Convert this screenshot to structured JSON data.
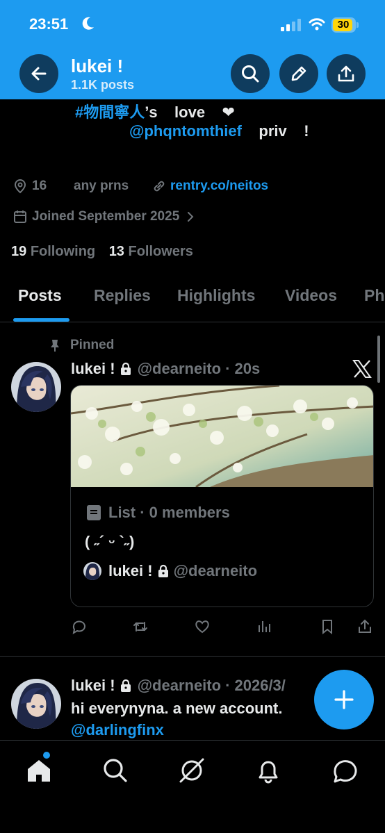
{
  "status_bar": {
    "time": "23:51",
    "battery": "30",
    "battery_color": "#ffd60a"
  },
  "header": {
    "name": "lukei !",
    "post_count": "1.1K posts",
    "background": "#1d9bf0",
    "buttons": [
      "back-icon",
      "search-icon",
      "edit-icon",
      "share-icon"
    ]
  },
  "bio": {
    "hashtag": "#物間寧人",
    "line1_rest": "’s    love    ❤",
    "mention": "@phqntomthief",
    "line2_rest": "    priv    !"
  },
  "meta": {
    "location": "16",
    "pronouns": "any prns",
    "link": "rentry.co/neitos",
    "joined": "Joined September 2025"
  },
  "stats": {
    "following_count": "19",
    "following_label": "Following",
    "followers_count": "13",
    "followers_label": "Followers"
  },
  "tabs": [
    {
      "label": "Posts",
      "active": true
    },
    {
      "label": "Replies",
      "active": false
    },
    {
      "label": "Highlights",
      "active": false
    },
    {
      "label": "Videos",
      "active": false
    },
    {
      "label": "Ph",
      "active": false
    }
  ],
  "posts": [
    {
      "pinned_label": "Pinned",
      "name": "lukei !",
      "handle": "@dearneito",
      "time": "· 20s",
      "card": {
        "meta": "List · 0 members",
        "description": "( ˶´ ᵕ `˶)",
        "owner_name": "lukei !",
        "owner_handle": "@dearneito"
      }
    },
    {
      "name": "lukei !",
      "handle": "@dearneito",
      "time": "· 2026/3/",
      "text": "hi everynyna. a new account.",
      "mention": "@darlingfinx"
    }
  ],
  "bottom_nav": [
    "home-icon",
    "search-icon",
    "grok-icon",
    "notifications-icon",
    "messages-icon"
  ],
  "accent": "#1d9bf0"
}
